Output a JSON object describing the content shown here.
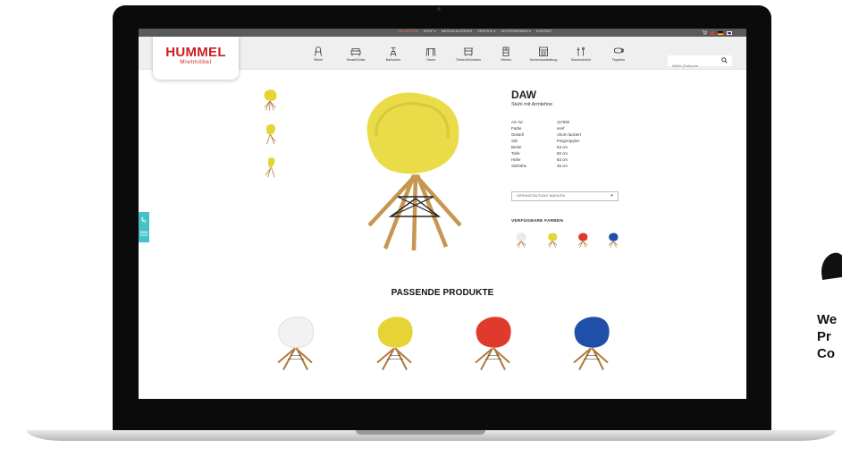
{
  "topbar": {
    "menu": [
      "NEUHEITEN",
      "SHOP ▾",
      "MESSEKALENDER",
      "SERVICE ▾",
      "UNTERNEHMEN ▾",
      "KONTAKT"
    ],
    "active_index": 0,
    "cart_icon": "cart-icon",
    "flags": [
      "de",
      "en"
    ]
  },
  "logo": {
    "name": "HUMMEL",
    "tagline": "Mietmöbel"
  },
  "nav": {
    "items": [
      {
        "label": "Stühle",
        "icon": "chair-icon"
      },
      {
        "label": "Sessel/Sofas",
        "icon": "sofa-icon"
      },
      {
        "label": "Barhocker",
        "icon": "barstool-icon"
      },
      {
        "label": "Tische",
        "icon": "table-icon"
      },
      {
        "label": "Theken/Schränke",
        "icon": "counter-icon"
      },
      {
        "label": "Vitrinen",
        "icon": "vitrine-icon"
      },
      {
        "label": "Küchenausstattung",
        "icon": "kitchen-icon"
      },
      {
        "label": "Standzubehör",
        "icon": "accessory-icon"
      },
      {
        "label": "Teppiche",
        "icon": "rug-icon"
      }
    ]
  },
  "search": {
    "placeholder": "Mitteln (Textsuche"
  },
  "product": {
    "name": "DAW",
    "subtitle": "Stuhl mit Armlehne",
    "specs": [
      {
        "key": "Art.-Nr.",
        "value": "117802"
      },
      {
        "key": "Farbe",
        "value": "senf"
      },
      {
        "key": "Gestell",
        "value": "Ahorn lackiert"
      },
      {
        "key": "Sitz",
        "value": "Polypropylen"
      },
      {
        "key": "Breite",
        "value": "63 cm"
      },
      {
        "key": "Tiefe",
        "value": "60 cm"
      },
      {
        "key": "Höhe",
        "value": "83 cm"
      },
      {
        "key": "Sitzhöhe",
        "value": "46 cm"
      }
    ],
    "event_select": "VERANSTALTUNG WÄHLEN",
    "colors_title": "VERFÜGBARE FARBEN",
    "color_swatches": [
      "#eaeaea",
      "#e6d436",
      "#e03a2c",
      "#1f4fa8"
    ],
    "main_color": "#e9dc48"
  },
  "related": {
    "title": "PASSENDE PRODUKTE",
    "items": [
      "#f2f2f2",
      "#e6d436",
      "#e03a2c",
      "#1f4fa8"
    ]
  },
  "decor_text": "We\nPr\nCo"
}
